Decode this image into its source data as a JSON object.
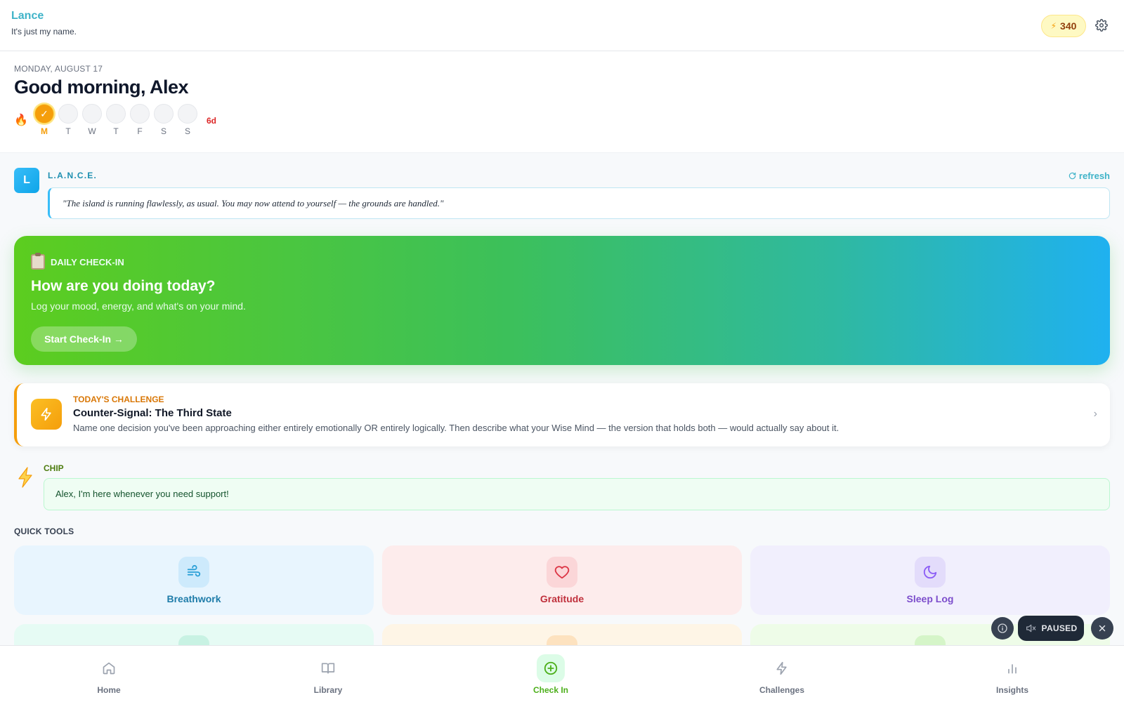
{
  "header": {
    "app_title": "Lance",
    "tagline": "It's just my name.",
    "points": "340"
  },
  "greeting": {
    "date": "MONDAY, AUGUST 17",
    "title": "Good morning, Alex",
    "streak_count": "6d",
    "days": [
      {
        "label": "M",
        "done": true
      },
      {
        "label": "T",
        "done": false
      },
      {
        "label": "W",
        "done": false
      },
      {
        "label": "T",
        "done": false
      },
      {
        "label": "F",
        "done": false
      },
      {
        "label": "S",
        "done": false
      },
      {
        "label": "S",
        "done": false
      }
    ],
    "check_mark": "✓"
  },
  "lance": {
    "avatar_letter": "L",
    "name": "L.A.N.C.E.",
    "refresh_label": "refresh",
    "quote": "\"The island is running flawlessly, as usual. You may now attend to yourself — the grounds are handled.\""
  },
  "checkin": {
    "kicker": "DAILY CHECK-IN",
    "title": "How are you doing today?",
    "subtitle": "Log your mood, energy, and what's on your mind.",
    "button_label": "Start Check-In →"
  },
  "challenge": {
    "kicker": "TODAY'S CHALLENGE",
    "title": "Counter-Signal: The Third State",
    "description": "Name one decision you've been approaching either entirely emotionally OR entirely logically. Then describe what your Wise Mind — the version that holds both — would actually say about it."
  },
  "chip": {
    "name": "CHIP",
    "message": "Alex, I'm here whenever you need support!"
  },
  "quick_tools": {
    "label": "QUICK TOOLS",
    "items": [
      {
        "label": "Breathwork",
        "icon": "wind-icon"
      },
      {
        "label": "Gratitude",
        "icon": "heart-icon"
      },
      {
        "label": "Sleep Log",
        "icon": "moon-icon"
      }
    ]
  },
  "media": {
    "status": "PAUSED"
  },
  "nav": {
    "items": [
      {
        "label": "Home",
        "icon": "home-icon"
      },
      {
        "label": "Library",
        "icon": "book-icon"
      },
      {
        "label": "Check In",
        "icon": "plus-circle-icon",
        "active": true
      },
      {
        "label": "Challenges",
        "icon": "bolt-icon"
      },
      {
        "label": "Insights",
        "icon": "bar-chart-icon"
      }
    ]
  },
  "colors": {
    "accent_green": "#4caf1a",
    "accent_blue": "#38bdf8",
    "accent_orange": "#f59e0b"
  }
}
